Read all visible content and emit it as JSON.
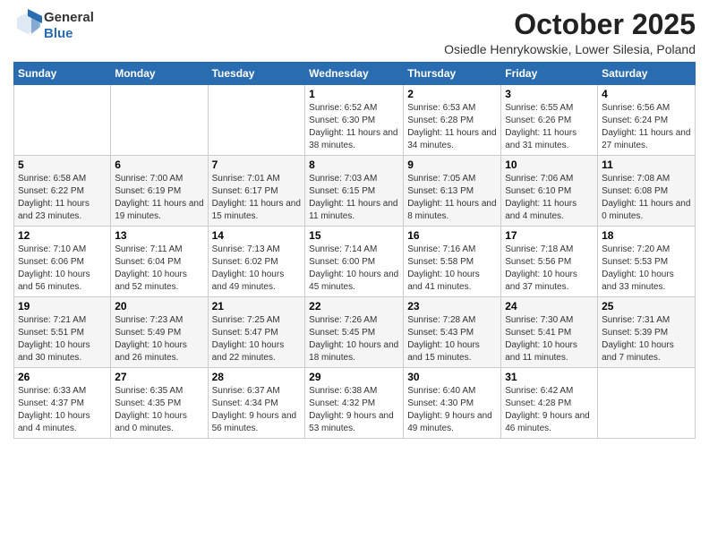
{
  "header": {
    "logo": {
      "line1": "General",
      "line2": "Blue"
    },
    "title": "October 2025",
    "subtitle": "Osiedle Henrykowskie, Lower Silesia, Poland"
  },
  "days_of_week": [
    "Sunday",
    "Monday",
    "Tuesday",
    "Wednesday",
    "Thursday",
    "Friday",
    "Saturday"
  ],
  "weeks": [
    {
      "days": [
        {
          "num": "",
          "info": ""
        },
        {
          "num": "",
          "info": ""
        },
        {
          "num": "",
          "info": ""
        },
        {
          "num": "1",
          "info": "Sunrise: 6:52 AM\nSunset: 6:30 PM\nDaylight: 11 hours and 38 minutes."
        },
        {
          "num": "2",
          "info": "Sunrise: 6:53 AM\nSunset: 6:28 PM\nDaylight: 11 hours and 34 minutes."
        },
        {
          "num": "3",
          "info": "Sunrise: 6:55 AM\nSunset: 6:26 PM\nDaylight: 11 hours and 31 minutes."
        },
        {
          "num": "4",
          "info": "Sunrise: 6:56 AM\nSunset: 6:24 PM\nDaylight: 11 hours and 27 minutes."
        }
      ]
    },
    {
      "days": [
        {
          "num": "5",
          "info": "Sunrise: 6:58 AM\nSunset: 6:22 PM\nDaylight: 11 hours and 23 minutes."
        },
        {
          "num": "6",
          "info": "Sunrise: 7:00 AM\nSunset: 6:19 PM\nDaylight: 11 hours and 19 minutes."
        },
        {
          "num": "7",
          "info": "Sunrise: 7:01 AM\nSunset: 6:17 PM\nDaylight: 11 hours and 15 minutes."
        },
        {
          "num": "8",
          "info": "Sunrise: 7:03 AM\nSunset: 6:15 PM\nDaylight: 11 hours and 11 minutes."
        },
        {
          "num": "9",
          "info": "Sunrise: 7:05 AM\nSunset: 6:13 PM\nDaylight: 11 hours and 8 minutes."
        },
        {
          "num": "10",
          "info": "Sunrise: 7:06 AM\nSunset: 6:10 PM\nDaylight: 11 hours and 4 minutes."
        },
        {
          "num": "11",
          "info": "Sunrise: 7:08 AM\nSunset: 6:08 PM\nDaylight: 11 hours and 0 minutes."
        }
      ]
    },
    {
      "days": [
        {
          "num": "12",
          "info": "Sunrise: 7:10 AM\nSunset: 6:06 PM\nDaylight: 10 hours and 56 minutes."
        },
        {
          "num": "13",
          "info": "Sunrise: 7:11 AM\nSunset: 6:04 PM\nDaylight: 10 hours and 52 minutes."
        },
        {
          "num": "14",
          "info": "Sunrise: 7:13 AM\nSunset: 6:02 PM\nDaylight: 10 hours and 49 minutes."
        },
        {
          "num": "15",
          "info": "Sunrise: 7:14 AM\nSunset: 6:00 PM\nDaylight: 10 hours and 45 minutes."
        },
        {
          "num": "16",
          "info": "Sunrise: 7:16 AM\nSunset: 5:58 PM\nDaylight: 10 hours and 41 minutes."
        },
        {
          "num": "17",
          "info": "Sunrise: 7:18 AM\nSunset: 5:56 PM\nDaylight: 10 hours and 37 minutes."
        },
        {
          "num": "18",
          "info": "Sunrise: 7:20 AM\nSunset: 5:53 PM\nDaylight: 10 hours and 33 minutes."
        }
      ]
    },
    {
      "days": [
        {
          "num": "19",
          "info": "Sunrise: 7:21 AM\nSunset: 5:51 PM\nDaylight: 10 hours and 30 minutes."
        },
        {
          "num": "20",
          "info": "Sunrise: 7:23 AM\nSunset: 5:49 PM\nDaylight: 10 hours and 26 minutes."
        },
        {
          "num": "21",
          "info": "Sunrise: 7:25 AM\nSunset: 5:47 PM\nDaylight: 10 hours and 22 minutes."
        },
        {
          "num": "22",
          "info": "Sunrise: 7:26 AM\nSunset: 5:45 PM\nDaylight: 10 hours and 18 minutes."
        },
        {
          "num": "23",
          "info": "Sunrise: 7:28 AM\nSunset: 5:43 PM\nDaylight: 10 hours and 15 minutes."
        },
        {
          "num": "24",
          "info": "Sunrise: 7:30 AM\nSunset: 5:41 PM\nDaylight: 10 hours and 11 minutes."
        },
        {
          "num": "25",
          "info": "Sunrise: 7:31 AM\nSunset: 5:39 PM\nDaylight: 10 hours and 7 minutes."
        }
      ]
    },
    {
      "days": [
        {
          "num": "26",
          "info": "Sunrise: 6:33 AM\nSunset: 4:37 PM\nDaylight: 10 hours and 4 minutes."
        },
        {
          "num": "27",
          "info": "Sunrise: 6:35 AM\nSunset: 4:35 PM\nDaylight: 10 hours and 0 minutes."
        },
        {
          "num": "28",
          "info": "Sunrise: 6:37 AM\nSunset: 4:34 PM\nDaylight: 9 hours and 56 minutes."
        },
        {
          "num": "29",
          "info": "Sunrise: 6:38 AM\nSunset: 4:32 PM\nDaylight: 9 hours and 53 minutes."
        },
        {
          "num": "30",
          "info": "Sunrise: 6:40 AM\nSunset: 4:30 PM\nDaylight: 9 hours and 49 minutes."
        },
        {
          "num": "31",
          "info": "Sunrise: 6:42 AM\nSunset: 4:28 PM\nDaylight: 9 hours and 46 minutes."
        },
        {
          "num": "",
          "info": ""
        }
      ]
    }
  ]
}
